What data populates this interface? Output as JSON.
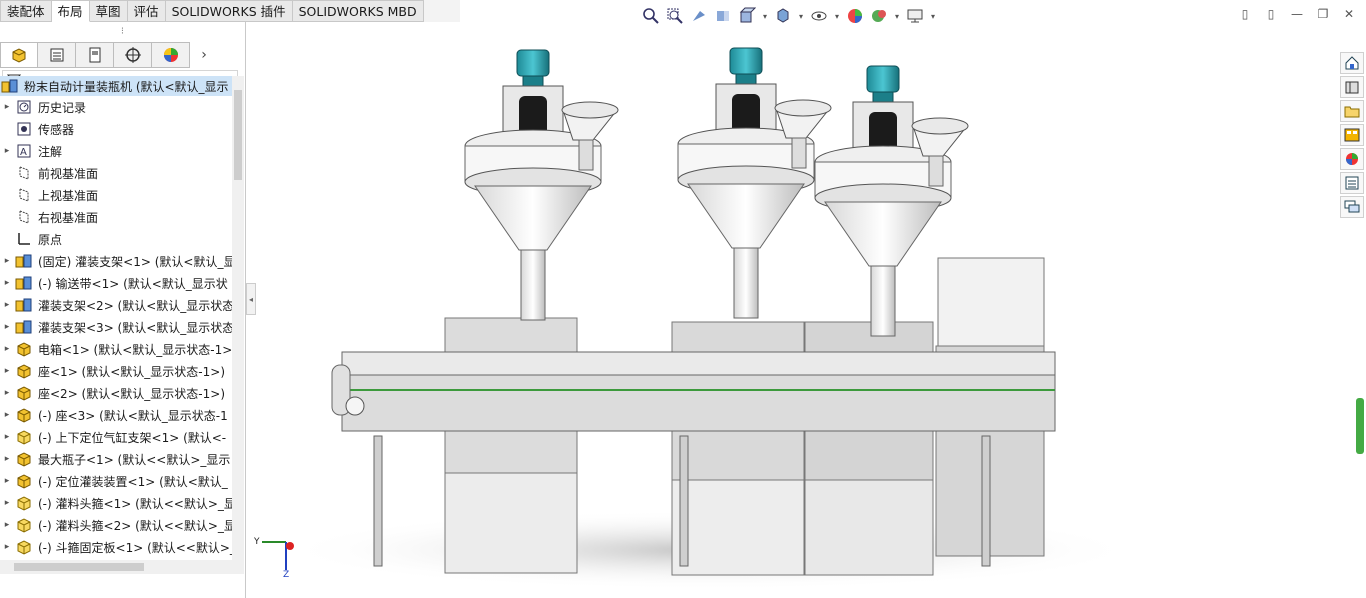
{
  "tabs": [
    {
      "label": "装配体",
      "active": false
    },
    {
      "label": "布局",
      "active": true
    },
    {
      "label": "草图",
      "active": false
    },
    {
      "label": "评估",
      "active": false
    },
    {
      "label": "SOLIDWORKS 插件",
      "active": false
    },
    {
      "label": "SOLIDWORKS MBD",
      "active": false
    }
  ],
  "panel": {
    "grip": "⁝",
    "root": "粉末自动计量装瓶机 (默认<默认_显示",
    "items": [
      {
        "label": "历史记录",
        "icon": "history-icon",
        "expandable": true
      },
      {
        "label": "传感器",
        "icon": "sensor-icon",
        "expandable": false
      },
      {
        "label": "注解",
        "icon": "annotation-icon",
        "expandable": true
      },
      {
        "label": "前视基准面",
        "icon": "plane-icon",
        "expandable": false
      },
      {
        "label": "上视基准面",
        "icon": "plane-icon",
        "expandable": false
      },
      {
        "label": "右视基准面",
        "icon": "plane-icon",
        "expandable": false
      },
      {
        "label": "原点",
        "icon": "origin-icon",
        "expandable": false
      },
      {
        "label": "(固定) 灌装支架<1> (默认<默认_显",
        "icon": "subassembly-icon",
        "expandable": true
      },
      {
        "label": "(-) 输送带<1> (默认<默认_显示状",
        "icon": "subassembly-icon",
        "expandable": true
      },
      {
        "label": "灌装支架<2> (默认<默认_显示状态",
        "icon": "subassembly-icon",
        "expandable": true
      },
      {
        "label": "灌装支架<3> (默认<默认_显示状态",
        "icon": "subassembly-icon",
        "expandable": true
      },
      {
        "label": "电箱<1> (默认<默认_显示状态-1>",
        "icon": "part-icon",
        "expandable": true
      },
      {
        "label": "座<1> (默认<默认_显示状态-1>)",
        "icon": "part-icon",
        "expandable": true
      },
      {
        "label": "座<2> (默认<默认_显示状态-1>)",
        "icon": "part-icon",
        "expandable": true
      },
      {
        "label": "(-) 座<3> (默认<默认_显示状态-1",
        "icon": "part-icon",
        "expandable": true
      },
      {
        "label": "(-) 上下定位气缸支架<1> (默认<-",
        "icon": "part-yellow-icon",
        "expandable": true
      },
      {
        "label": "最大瓶子<1> (默认<<默认>_显示",
        "icon": "part-icon",
        "expandable": true
      },
      {
        "label": "(-) 定位灌装装置<1> (默认<默认_",
        "icon": "part-icon",
        "expandable": true
      },
      {
        "label": "(-) 灌料头箍<1> (默认<<默认>_显",
        "icon": "part-yellow-icon",
        "expandable": true
      },
      {
        "label": "(-) 灌料头箍<2> (默认<<默认>_显",
        "icon": "part-yellow-icon",
        "expandable": true
      },
      {
        "label": "(-) 斗箍固定板<1> (默认<<默认>_",
        "icon": "part-yellow-icon",
        "expandable": true
      }
    ]
  },
  "triad": {
    "x": "Z",
    "y": "Y"
  },
  "colors": {
    "tab_bg": "#e9e9e9",
    "selection": "#cde3f7",
    "machine_gray": "#d9d9d9",
    "motor_teal": "#2aa7b4"
  }
}
